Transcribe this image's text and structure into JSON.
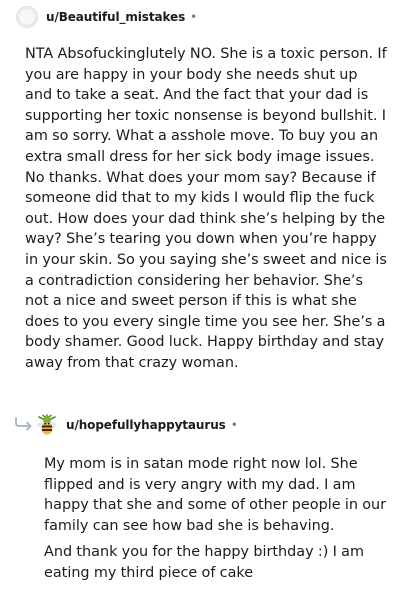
{
  "comment": {
    "username": "u/Beautiful_mistakes",
    "separator": "•",
    "text": "NTA Absofuckinglutely NO. She is a toxic person. If you are happy in your body she needs shut up and to take a seat. And the fact that your dad is supporting her toxic nonsense is beyond bullshit. I am so sorry. What a asshole move. To buy you an extra small dress for her sick body image issues. No thanks. What does your mom say? Because if someone did that to my kids I would flip the fuck out. How does your dad think she’s helping by the way? She’s tearing you down when you’re happy in your skin. So you saying she’s sweet and nice is a contradiction considering her behavior. She’s not a nice and sweet person if this is what she does to you every single time you see her. She’s a body shamer. Good luck. Happy birthday and stay away from that crazy woman."
  },
  "reply": {
    "username": "u/hopefullyhappytaurus",
    "separator": "•",
    "paragraphs": [
      "My mom is in satan mode right now lol. She flipped and is very angry with my dad. I am happy that she and some of other people in our family can see how bad she is behaving.",
      "And thank you for the happy birthday :) I am eating my third piece of cake"
    ]
  },
  "icons": {
    "avatar_1": "default-avatar-icon",
    "reply_arrow": "reply-arrow-icon",
    "avatar_2": "bee-avatar-icon"
  }
}
